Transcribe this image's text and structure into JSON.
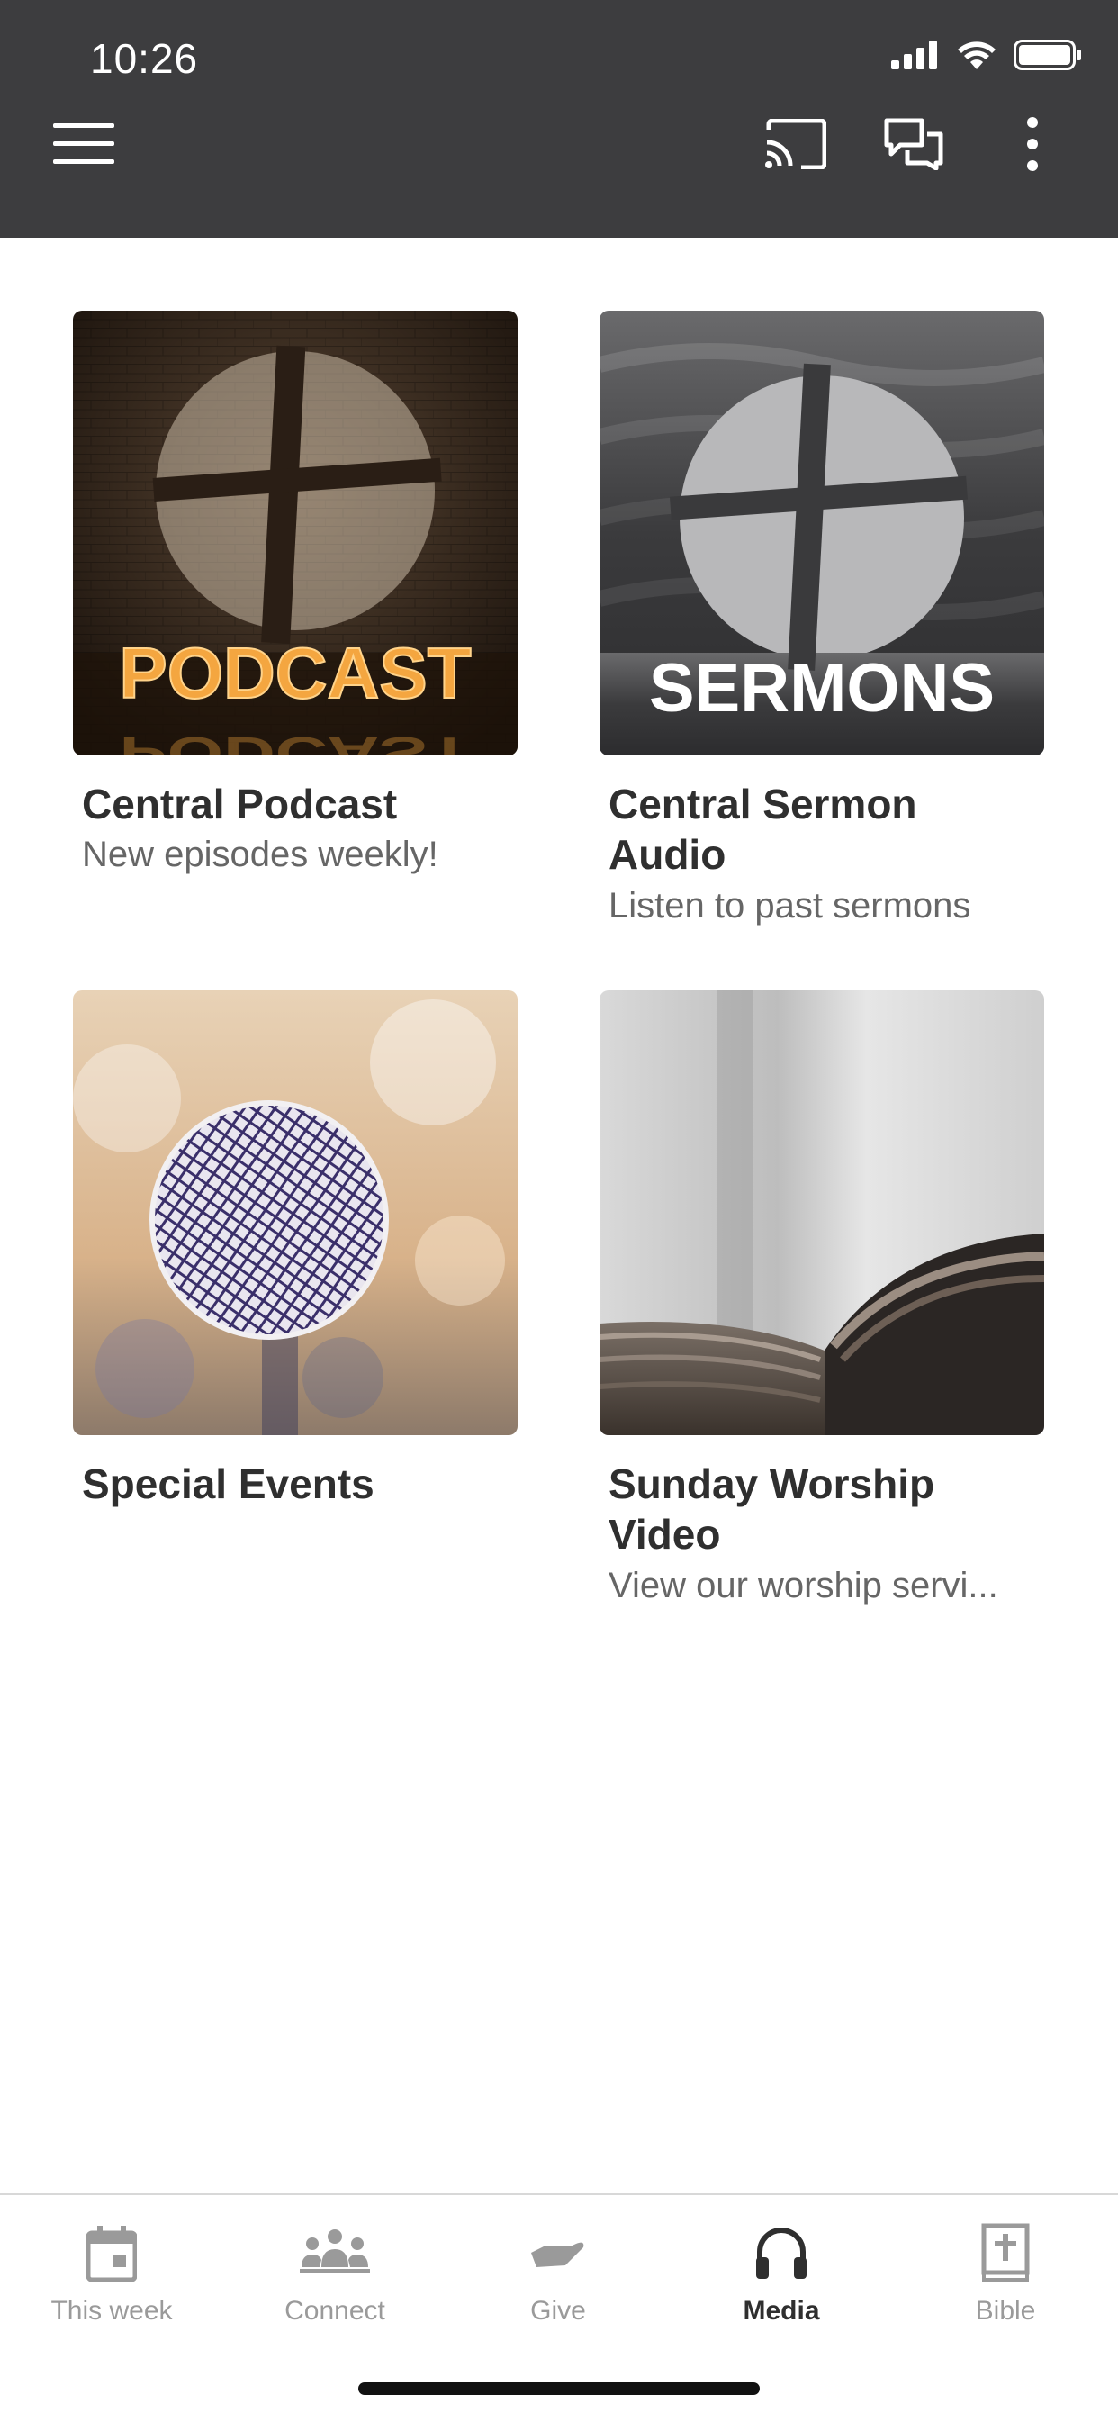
{
  "status_bar": {
    "time": "10:26"
  },
  "toolbar": {
    "menu_icon": "hamburger-icon",
    "cast_icon": "cast-icon",
    "chat_icon": "chat-icon",
    "more_icon": "more-vertical-icon"
  },
  "media": {
    "items": [
      {
        "title": "Central Podcast",
        "subtitle": "New episodes weekly!",
        "image_text": "PODCAST"
      },
      {
        "title": "Central Sermon Audio",
        "subtitle": "Listen to past sermons",
        "image_text": "SERMONS"
      },
      {
        "title": "Special Events",
        "subtitle": ""
      },
      {
        "title": "Sunday Worship Video",
        "subtitle": "View our worship servi..."
      }
    ]
  },
  "tabs": [
    {
      "label": "This week",
      "icon": "calendar-icon",
      "active": false
    },
    {
      "label": "Connect",
      "icon": "people-icon",
      "active": false
    },
    {
      "label": "Give",
      "icon": "give-hand-icon",
      "active": false
    },
    {
      "label": "Media",
      "icon": "headphones-icon",
      "active": true
    },
    {
      "label": "Bible",
      "icon": "bible-icon",
      "active": false
    }
  ],
  "colors": {
    "header_bg": "#3d3d3f",
    "accent_active": "#2f2f2f",
    "inactive": "#9a9a9a"
  }
}
